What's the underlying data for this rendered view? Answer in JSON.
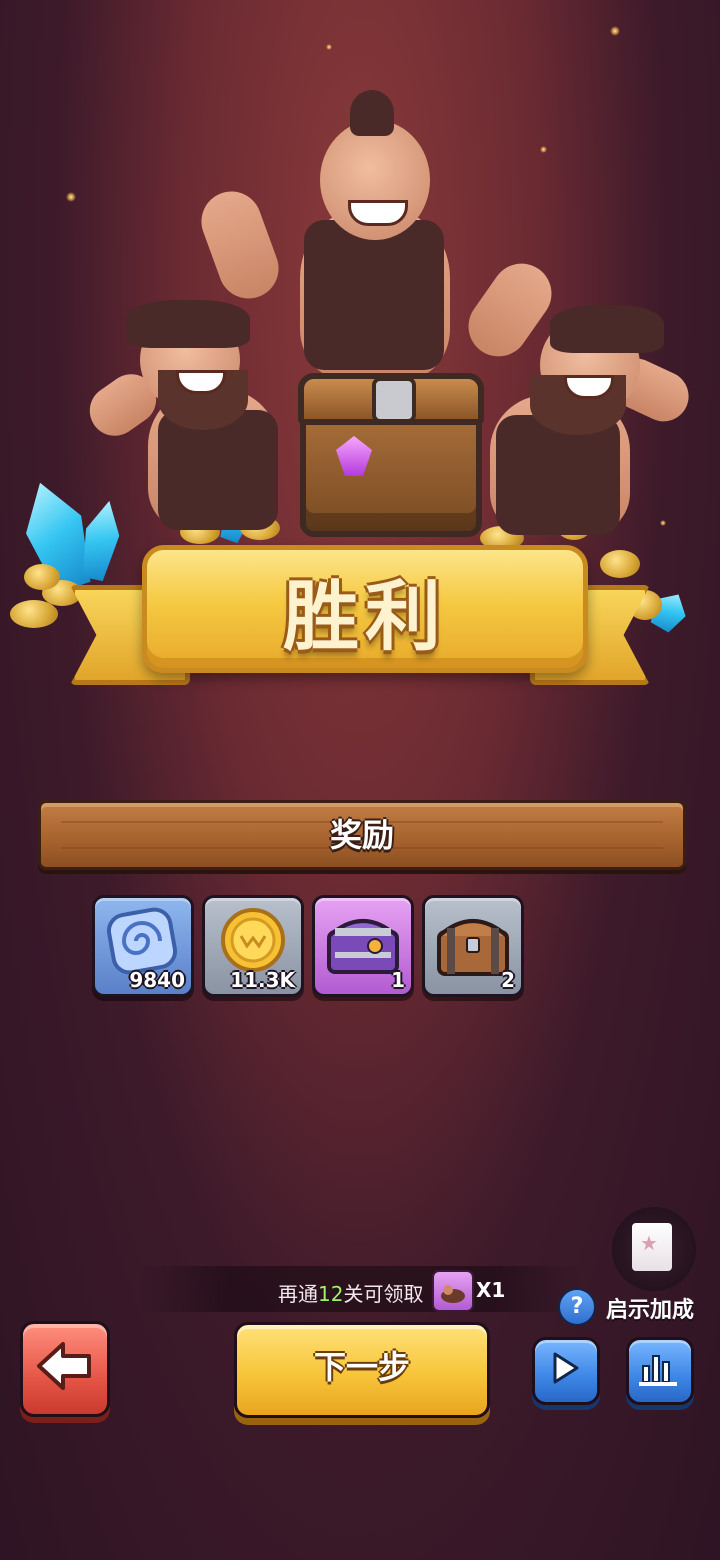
{
  "result": {
    "title": "胜利"
  },
  "rewards": {
    "header": "奖励",
    "items": [
      {
        "icon": "spiral-token-icon",
        "count": "9840"
      },
      {
        "icon": "gold-coin-icon",
        "count": "11.3K"
      },
      {
        "icon": "purple-chest-icon",
        "count": "1"
      },
      {
        "icon": "wooden-chest-icon",
        "count": "2"
      }
    ]
  },
  "progress": {
    "prefix": "再通",
    "levels": "12",
    "suffix": "关可领取",
    "reward_icon": "caveman-card-icon",
    "multiplier": "X1"
  },
  "bonus": {
    "label": "启示加成",
    "help_icon": "question-icon",
    "card_icon": "star-scroll-icon"
  },
  "buttons": {
    "back_icon": "arrow-left-icon",
    "next_label": "下一步",
    "play_icon": "play-icon",
    "stats_icon": "bar-chart-icon"
  },
  "colors": {
    "background": "#3d1a2a",
    "ribbon": "#f5c942",
    "next_button": "#f7c53a",
    "back_button": "#e65647",
    "blue_button": "#3d86e6",
    "highlight": "#9ef26b"
  }
}
